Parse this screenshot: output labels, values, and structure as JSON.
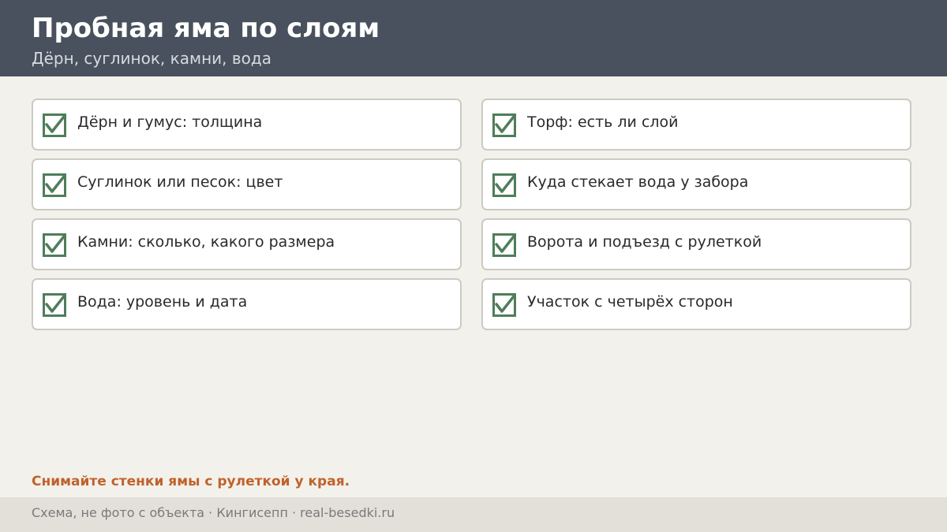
{
  "header": {
    "title": "Пробная яма по слоям",
    "subtitle": "Дёрн, суглинок, камни, вода"
  },
  "checklist": [
    {
      "label": "Дёрн и гумус: толщина",
      "checked": true,
      "icon": "checkbox-checked-icon"
    },
    {
      "label": "Торф: есть ли слой",
      "checked": true,
      "icon": "checkbox-checked-icon"
    },
    {
      "label": "Суглинок или песок: цвет",
      "checked": true,
      "icon": "checkbox-checked-icon"
    },
    {
      "label": "Куда стекает вода у забора",
      "checked": true,
      "icon": "checkbox-checked-icon"
    },
    {
      "label": "Камни: сколько, какого размера",
      "checked": true,
      "icon": "checkbox-checked-icon"
    },
    {
      "label": "Ворота и подъезд с рулеткой",
      "checked": true,
      "icon": "checkbox-checked-icon"
    },
    {
      "label": "Вода: уровень и дата",
      "checked": true,
      "icon": "checkbox-checked-icon"
    },
    {
      "label": "Участок с четырёх сторон",
      "checked": true,
      "icon": "checkbox-checked-icon"
    }
  ],
  "note": "Снимайте стенки ямы с рулеткой у края.",
  "footer": {
    "text": "Схема, не фото с объекта  ·  Кингисепп  ·  real-besedki.ru"
  },
  "colors": {
    "header_bg": "#48515d",
    "check_green": "#4f7d5b",
    "note_accent": "#c0622b",
    "page_bg": "#f3f1ec"
  }
}
